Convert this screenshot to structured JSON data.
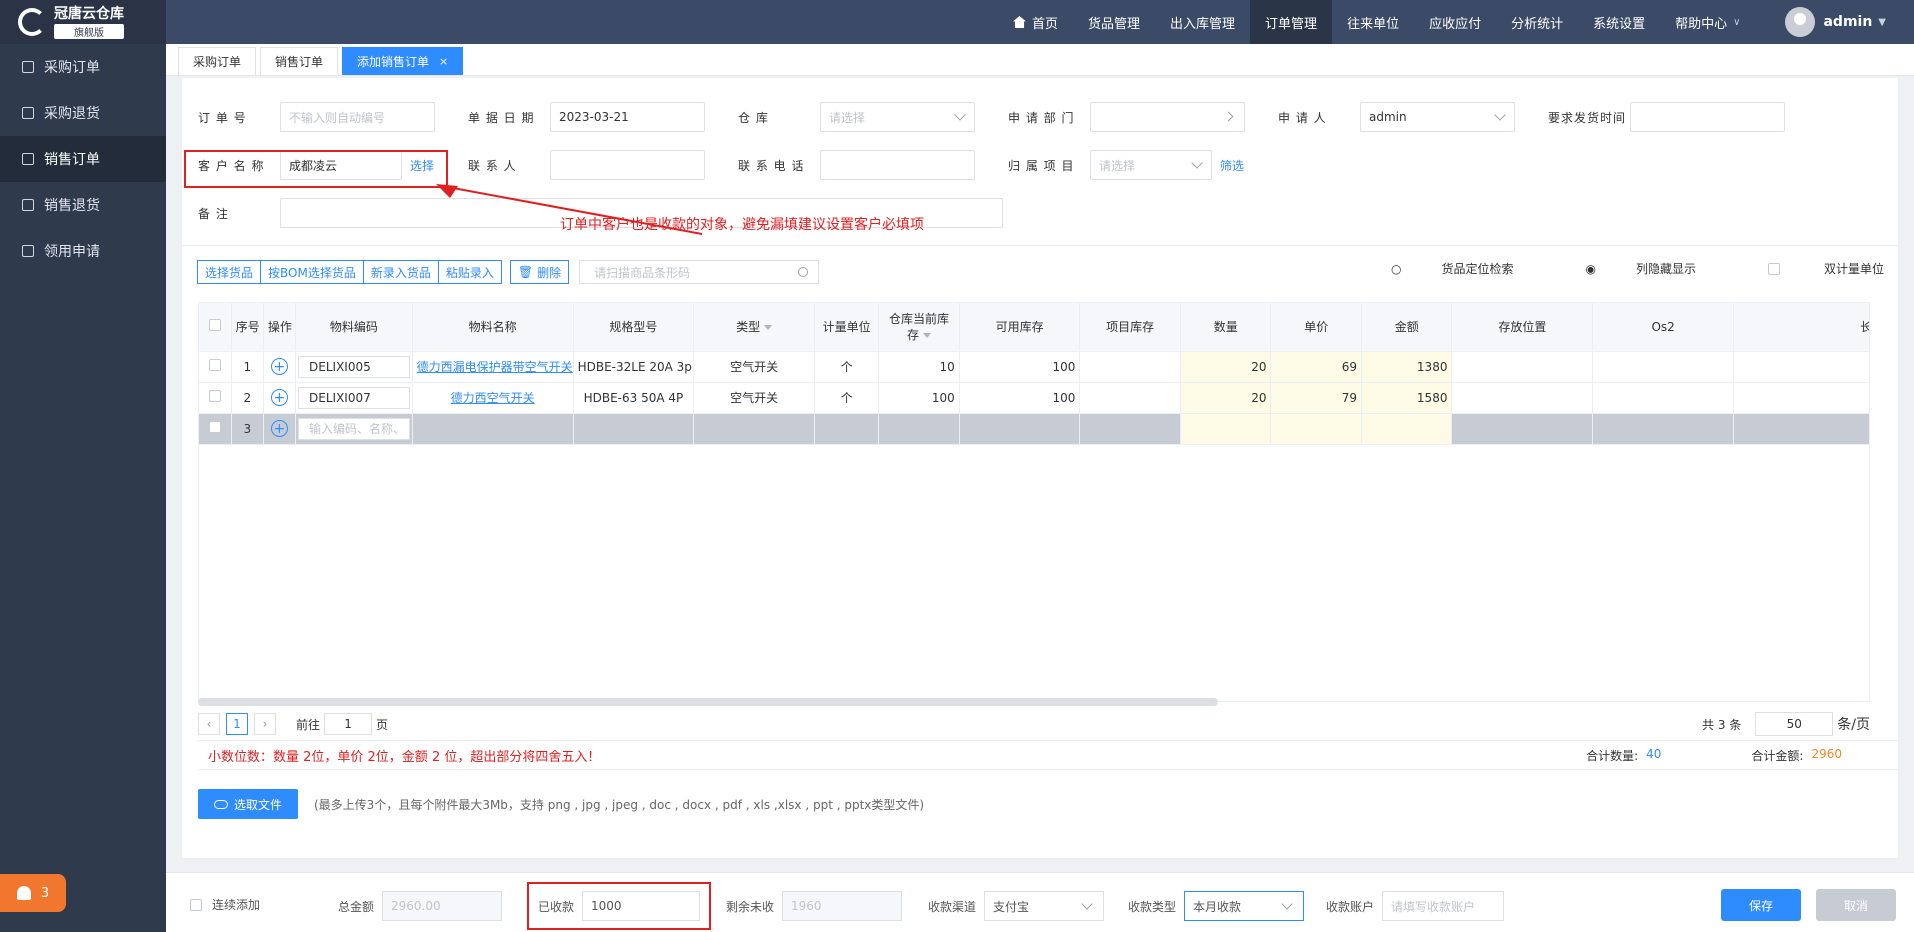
{
  "app": {
    "name": "冠唐云仓库",
    "edition": "旗舰版"
  },
  "sidebar": {
    "items": [
      {
        "label": "采购订单"
      },
      {
        "label": "采购退货"
      },
      {
        "label": "销售订单"
      },
      {
        "label": "销售退货"
      },
      {
        "label": "领用申请"
      }
    ],
    "alarm_count": "3"
  },
  "topnav": {
    "items": [
      {
        "label": "首页"
      },
      {
        "label": "货品管理"
      },
      {
        "label": "出入库管理"
      },
      {
        "label": "订单管理"
      },
      {
        "label": "往来单位"
      },
      {
        "label": "应收应付"
      },
      {
        "label": "分析统计"
      },
      {
        "label": "系统设置"
      },
      {
        "label": "帮助中心"
      }
    ],
    "user": "admin"
  },
  "tabs": [
    {
      "label": "采购订单"
    },
    {
      "label": "销售订单"
    },
    {
      "label": "添加销售订单"
    }
  ],
  "form": {
    "order_no": {
      "label": "订 单 号",
      "placeholder": "不输入则自动编号"
    },
    "date": {
      "label": "单 据 日 期",
      "value": "2023-03-21"
    },
    "warehouse": {
      "label": "仓 库",
      "placeholder": "请选择"
    },
    "dept": {
      "label": "申 请 部 门"
    },
    "applicant": {
      "label": "申 请 人",
      "value": "admin"
    },
    "ship_time": {
      "label": "要求发货时间"
    },
    "customer": {
      "label": "客 户 名 称",
      "value": "成都凌云",
      "action": "选择"
    },
    "contact": {
      "label": "联 系 人"
    },
    "phone": {
      "label": "联 系 电 话"
    },
    "project": {
      "label": "归 属 项 目",
      "placeholder": "请选择",
      "action": "筛选"
    },
    "remark": {
      "label": "备 注"
    }
  },
  "annotation": "订单中客户也是收款的对象，避免漏填建议设置客户必填项",
  "toolbar": {
    "buttons": [
      "选择货品",
      "按BOM选择货品",
      "新录入货品",
      "粘贴录入"
    ],
    "delete": "删除",
    "scan_placeholder": "请扫描商品条形码",
    "locate": "货品定位检索",
    "hide_cols": "列隐藏显示",
    "dual_unit": "双计量单位"
  },
  "table": {
    "headers": [
      "序号",
      "操作",
      "物料编码",
      "物料名称",
      "规格型号",
      "类型",
      "计量单位",
      "仓库当前库存",
      "可用库存",
      "项目库存",
      "数量",
      "单价",
      "金额",
      "存放位置",
      "Os2",
      "长"
    ],
    "rows": [
      {
        "idx": "1",
        "code": "DELIXI005",
        "name": "德力西漏电保护器带空气开关",
        "spec": "HDBE-32LE 20A 3p",
        "type": "空气开关",
        "unit": "个",
        "stock": "10",
        "avail": "100",
        "proj": "",
        "qty": "20",
        "price": "69",
        "amount": "1380"
      },
      {
        "idx": "2",
        "code": "DELIXI007",
        "name": "德力西空气开关",
        "spec": "HDBE-63 50A 4P",
        "type": "空气开关",
        "unit": "个",
        "stock": "100",
        "avail": "100",
        "proj": "",
        "qty": "20",
        "price": "79",
        "amount": "1580"
      }
    ],
    "new_row": {
      "idx": "3",
      "placeholder": "输入编码、名称、"
    }
  },
  "pager": {
    "current": "1",
    "goto_prefix": "前往",
    "goto_value": "1",
    "goto_suffix": "页",
    "total": "共 3 条",
    "size": "50",
    "size_unit": "条/页"
  },
  "summary": {
    "tip": "小数位数：数量 2位，单价 2位，金额 2 位，超出部分将四舍五入！",
    "qty_label": "合计数量:",
    "qty": "40",
    "amount_label": "合计金额:",
    "amount": "2960"
  },
  "upload": {
    "button": "选取文件",
    "hint": "(最多上传3个，且每个附件最大3Mb，支持 png , jpg , jpeg , doc , docx , pdf , xls ,xlsx , ppt , pptx类型文件)"
  },
  "footer": {
    "continue_label": "连续添加",
    "total_label": "总金额",
    "total": "2960.00",
    "received_label": "已收款",
    "received": "1000",
    "remaining_label": "剩余未收",
    "remaining": "1960",
    "channel_label": "收款渠道",
    "channel": "支付宝",
    "type_label": "收款类型",
    "type": "本月收款",
    "account_label": "收款账户",
    "account_placeholder": "请填写收款账户",
    "save": "保存",
    "cancel": "取消"
  },
  "colors": {
    "accent": "#2f8cff",
    "sidebar": "#2f3a4d",
    "topbar": "#3b4a66",
    "alert": "#e02020",
    "amount": "#f08a24"
  }
}
